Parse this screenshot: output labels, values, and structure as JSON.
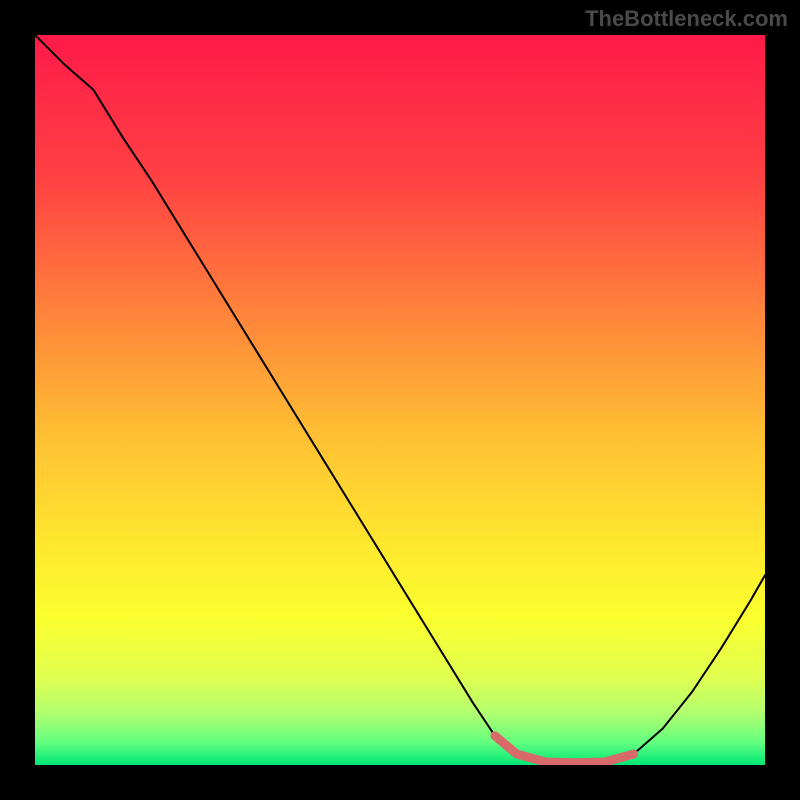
{
  "watermark": "TheBottleneck.com",
  "chart_data": {
    "type": "line",
    "title": "",
    "xlabel": "",
    "ylabel": "",
    "xlim": [
      0,
      100
    ],
    "ylim": [
      0,
      100
    ],
    "background_gradient": {
      "stops": [
        {
          "offset": 0,
          "color": "#ff1a49"
        },
        {
          "offset": 20,
          "color": "#ff4243"
        },
        {
          "offset": 40,
          "color": "#ff8a3a"
        },
        {
          "offset": 55,
          "color": "#ffc033"
        },
        {
          "offset": 70,
          "color": "#ffe82e"
        },
        {
          "offset": 80,
          "color": "#faff2e"
        },
        {
          "offset": 88,
          "color": "#e0ff50"
        },
        {
          "offset": 93,
          "color": "#b0ff70"
        },
        {
          "offset": 97,
          "color": "#60ff80"
        },
        {
          "offset": 100,
          "color": "#00e676"
        }
      ]
    },
    "series": [
      {
        "name": "bottleneck-curve",
        "color": "#000000",
        "width": 2,
        "x": [
          0,
          4,
          8,
          12,
          16,
          20,
          24,
          28,
          32,
          36,
          40,
          44,
          48,
          52,
          56,
          60,
          63,
          66,
          70,
          74,
          78,
          82,
          86,
          90,
          94,
          98,
          100
        ],
        "values": [
          100,
          96,
          92.5,
          86,
          80,
          73.5,
          67,
          60.5,
          54,
          47.5,
          41,
          34.5,
          28,
          21.5,
          15,
          8.5,
          4,
          1.5,
          0.4,
          0.3,
          0.4,
          1.5,
          5,
          10,
          16,
          22.5,
          26
        ]
      },
      {
        "name": "highlight-region",
        "color": "#d96a6a",
        "width": 9,
        "x": [
          63,
          66,
          70,
          74,
          78,
          82
        ],
        "values": [
          4,
          1.5,
          0.4,
          0.3,
          0.4,
          1.5
        ]
      }
    ]
  }
}
